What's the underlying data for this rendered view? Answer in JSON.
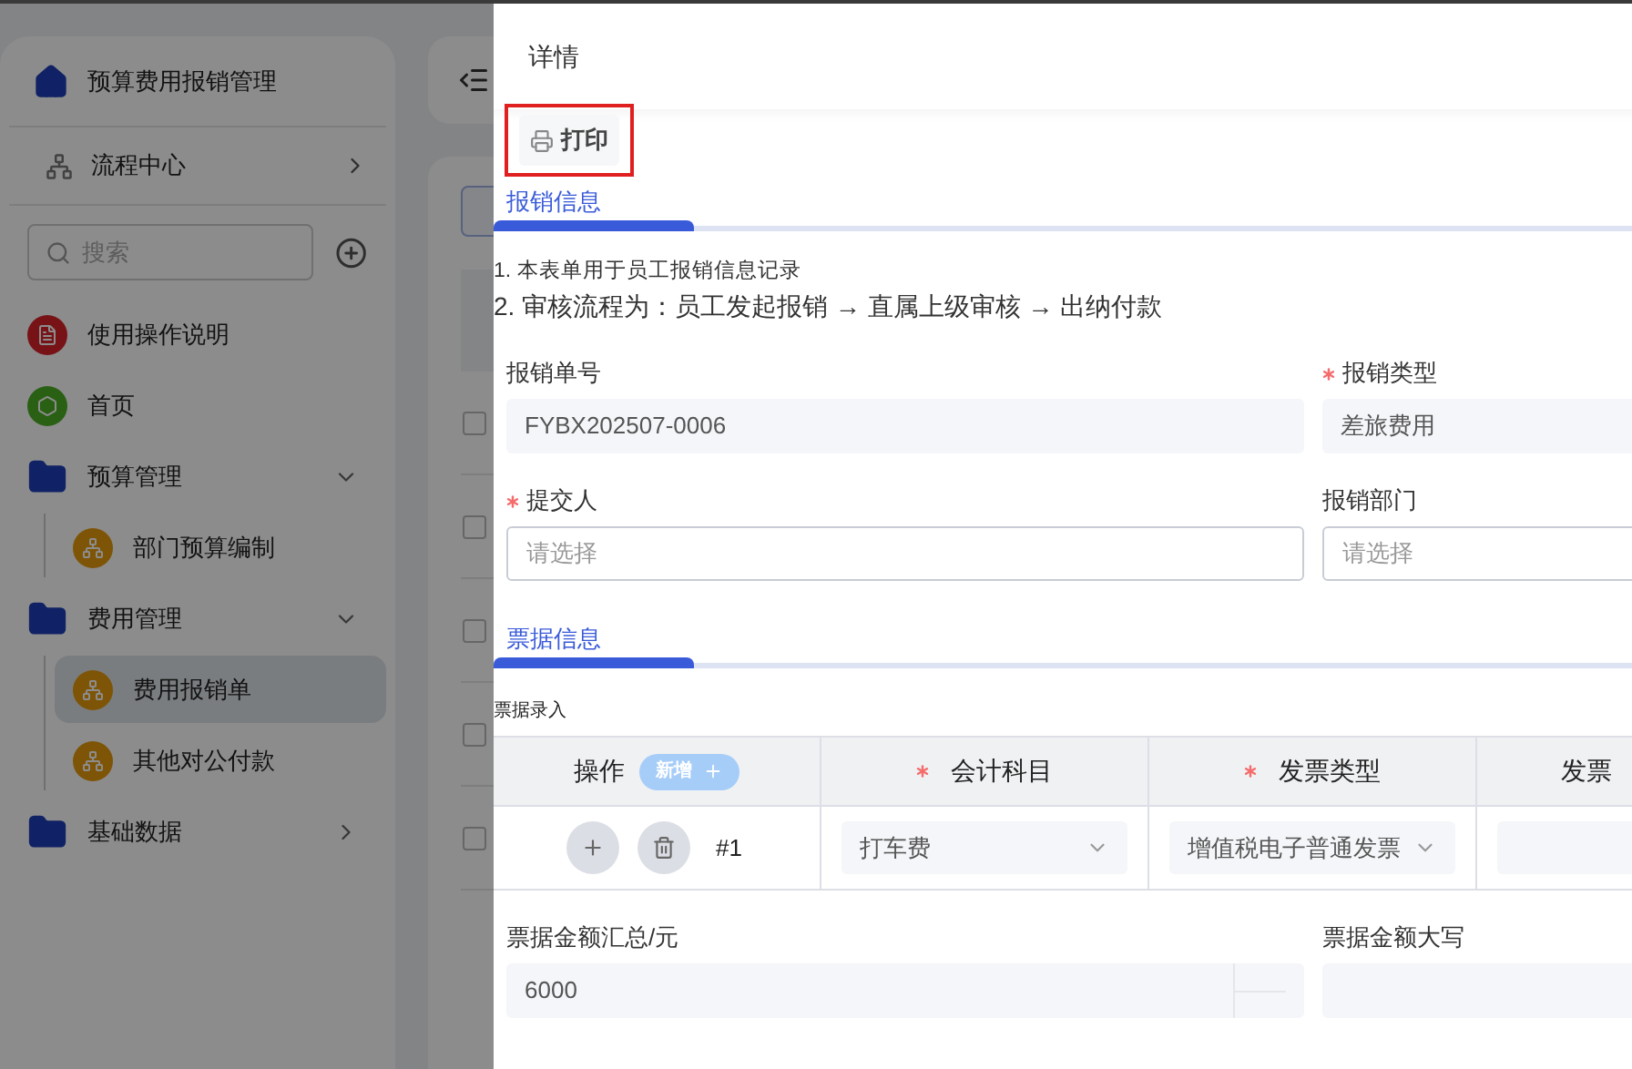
{
  "sidebar": {
    "title": "预算费用报销管理",
    "flow": {
      "label": "流程中心"
    },
    "search": {
      "placeholder": "搜索"
    },
    "items": [
      {
        "label": "使用操作说明",
        "kind": "guide",
        "selected": false
      },
      {
        "label": "首页",
        "kind": "home",
        "selected": false
      },
      {
        "label": "预算管理",
        "kind": "folder",
        "expanded": true,
        "selected": false,
        "children": [
          {
            "label": "部门预算编制",
            "kind": "page",
            "selected": false
          }
        ]
      },
      {
        "label": "费用管理",
        "kind": "folder",
        "expanded": true,
        "selected": false,
        "children": [
          {
            "label": "费用报销单",
            "kind": "page",
            "selected": true
          },
          {
            "label": "其他对公付款",
            "kind": "page",
            "selected": false
          }
        ]
      },
      {
        "label": "基础数据",
        "kind": "folder",
        "expanded": false,
        "selected": false
      }
    ]
  },
  "background_table": {
    "rows": [
      {
        "checked": false
      },
      {
        "checked": false
      },
      {
        "checked": false
      },
      {
        "checked": false
      },
      {
        "checked": false
      }
    ]
  },
  "drawer": {
    "title": "详情",
    "print_button": {
      "label": "打印",
      "highlighted": true
    },
    "reimbursement_section": {
      "title": "报销信息",
      "notes": [
        "1. 本表单用于员工报销信息记录",
        "2. 审核流程为：员工发起报销 → 直属上级审核 → 出纳付款"
      ],
      "fields": [
        {
          "label": "报销单号",
          "required": false,
          "kind": "text",
          "disabled": true,
          "value": "FYBX202507-0006"
        },
        {
          "label": "报销类型",
          "required": true,
          "kind": "text",
          "disabled": true,
          "value": "差旅费用"
        },
        {
          "label": "提交人",
          "required": true,
          "kind": "text",
          "disabled": false,
          "placeholder": "请选择"
        },
        {
          "label": "报销部门",
          "required": false,
          "kind": "text",
          "disabled": false,
          "placeholder": "请选择"
        }
      ]
    },
    "invoice_section": {
      "title": "票据信息",
      "subtitle": "票据录入",
      "table": {
        "columns": [
          {
            "label": "操作",
            "required": false,
            "add_button": "新增"
          },
          {
            "label": "会计科目",
            "required": true
          },
          {
            "label": "发票类型",
            "required": true
          },
          {
            "label": "发票",
            "required": false
          }
        ],
        "rows": [
          {
            "number": "#1",
            "values": [
              "打车费",
              "增值税电子普通发票"
            ]
          }
        ]
      },
      "fields": [
        {
          "label": "票据金额汇总/元",
          "required": false,
          "kind": "number",
          "disabled": true,
          "value": "6000"
        },
        {
          "label": "票据金额大写",
          "required": false,
          "kind": "text",
          "disabled": true
        }
      ]
    }
  }
}
